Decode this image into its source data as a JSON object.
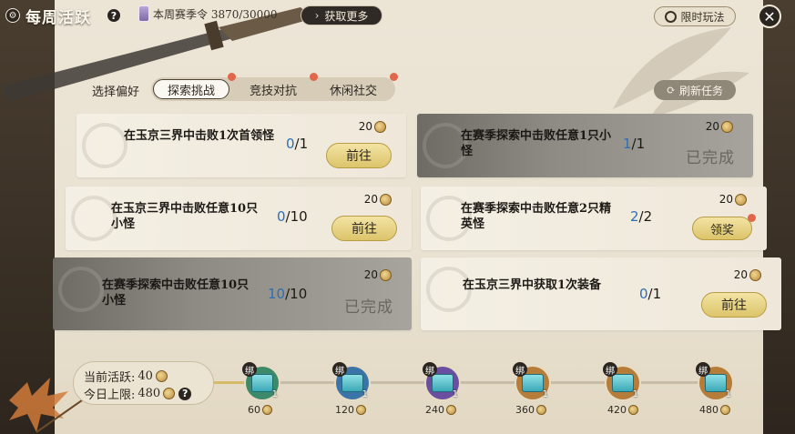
{
  "header": {
    "title": "每周活跃",
    "help": "?",
    "season_token_text": "本周赛季令 3870/30000",
    "get_more": "获取更多",
    "limited_mode": "限时玩法",
    "close": "✕"
  },
  "preferences": {
    "label": "选择偏好",
    "tabs": [
      "探索挑战",
      "竞技对抗",
      "休闲社交"
    ],
    "refresh": "刷新任务"
  },
  "tasks": [
    {
      "text": "在玉京三界中击败1次首领怪",
      "current": "0",
      "total": "/1",
      "reward": "20",
      "action": "前往",
      "status": "go"
    },
    {
      "text": "在赛季探索中击败任意1只小怪",
      "current": "1",
      "total": "/1",
      "reward": "20",
      "action": "已完成",
      "status": "done"
    },
    {
      "text": "在玉京三界中击败任意10只小怪",
      "current": "0",
      "total": "/10",
      "reward": "20",
      "action": "前往",
      "status": "go"
    },
    {
      "text": "在赛季探索中击败任意2只精英怪",
      "current": "2",
      "total": "/2",
      "reward": "20",
      "action": "领奖",
      "status": "claim"
    },
    {
      "text": "在赛季探索中击败任意10只小怪",
      "current": "10",
      "total": "/10",
      "reward": "20",
      "action": "已完成",
      "status": "done"
    },
    {
      "text": "在玉京三界中获取1次装备",
      "current": "0",
      "total": "/1",
      "reward": "20",
      "action": "前往",
      "status": "go"
    }
  ],
  "activity": {
    "current_label": "当前活跃:",
    "current_value": "40",
    "limit_label": "今日上限:",
    "limit_value": "480",
    "help": "?"
  },
  "milestones": [
    {
      "value": "60",
      "qty": "1",
      "bound": "绑",
      "ring": "#3c8a6a"
    },
    {
      "value": "120",
      "qty": "1",
      "bound": "绑",
      "ring": "#3a74a8"
    },
    {
      "value": "240",
      "qty": "1",
      "bound": "绑",
      "ring": "#6a4fa0"
    },
    {
      "value": "360",
      "qty": "1",
      "bound": "绑",
      "ring": "#b57c3a"
    },
    {
      "value": "420",
      "qty": "1",
      "bound": "绑",
      "ring": "#b57c3a"
    },
    {
      "value": "480",
      "qty": "1",
      "bound": "绑",
      "ring": "#b57c3a"
    }
  ],
  "colors": {
    "accent_blue": "#2d6fb5",
    "button_gold": "#dcc46a",
    "notify_red": "#e0674a"
  }
}
